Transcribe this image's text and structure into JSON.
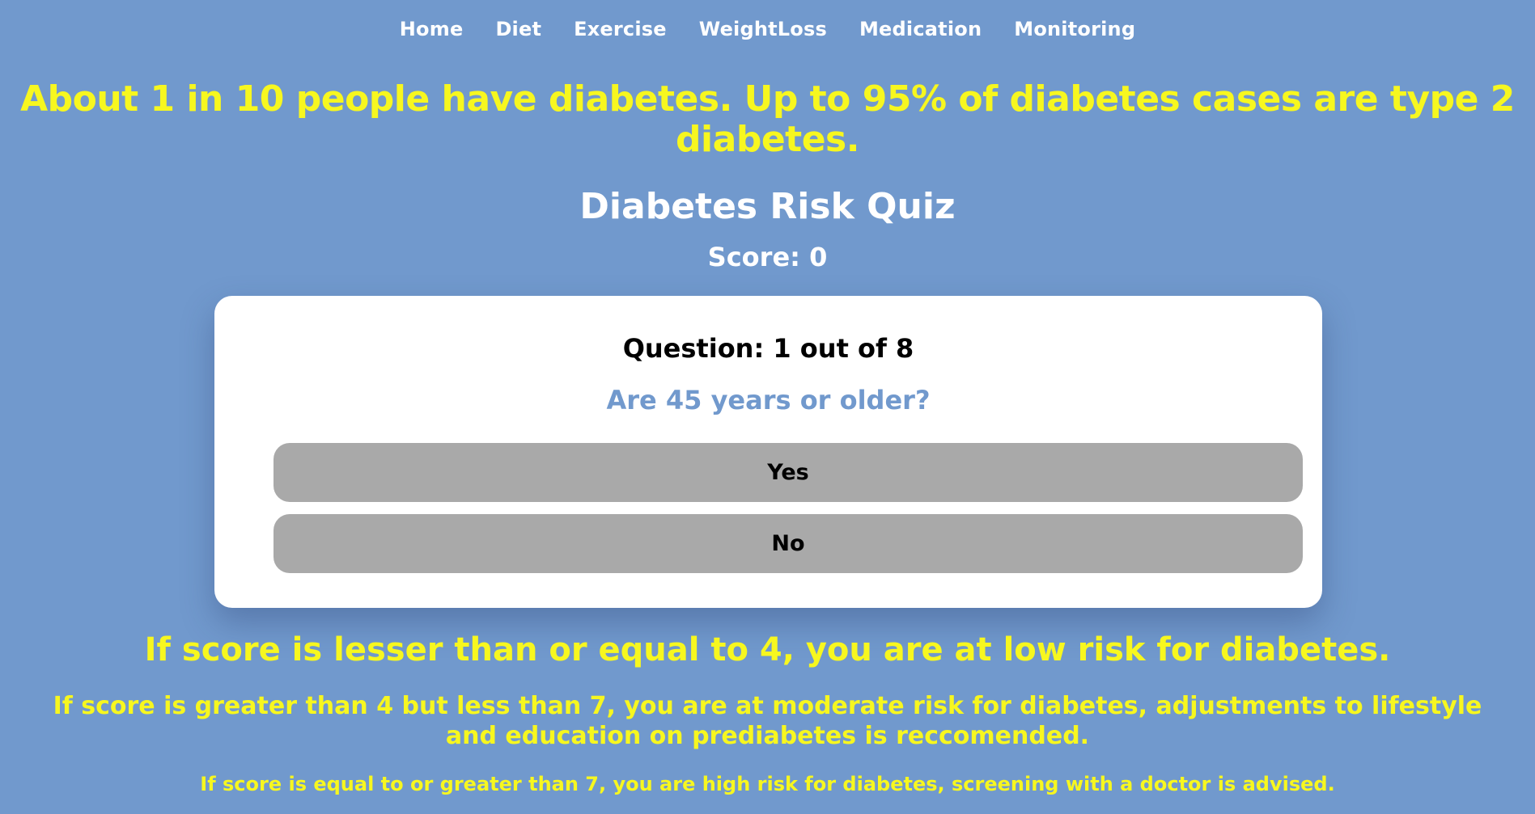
{
  "nav": {
    "items": [
      "Home",
      "Diet",
      "Exercise",
      "WeightLoss",
      "Medication",
      "Monitoring"
    ]
  },
  "headline": "About 1 in 10 people have diabetes. Up to 95% of diabetes cases are type 2 diabetes.",
  "quiz": {
    "title": "Diabetes Risk Quiz",
    "score_label": "Score: 0",
    "question_number": "Question: 1 out of 8",
    "question_text": "Are 45 years or older?",
    "answers": [
      "Yes",
      "No"
    ]
  },
  "info": {
    "low": "If score is lesser than or equal to 4, you are at low risk for diabetes.",
    "moderate": "If score is greater than 4 but less than 7, you are at moderate risk for diabetes, adjustments to lifestyle and education on prediabetes is reccomended.",
    "high": "If score is equal to or greater than 7, you are high risk for diabetes, screening with a doctor is advised."
  },
  "colors": {
    "background": "#7199cd",
    "highlight": "#f7f71f",
    "card": "#ffffff",
    "button": "#a9a9a9"
  }
}
